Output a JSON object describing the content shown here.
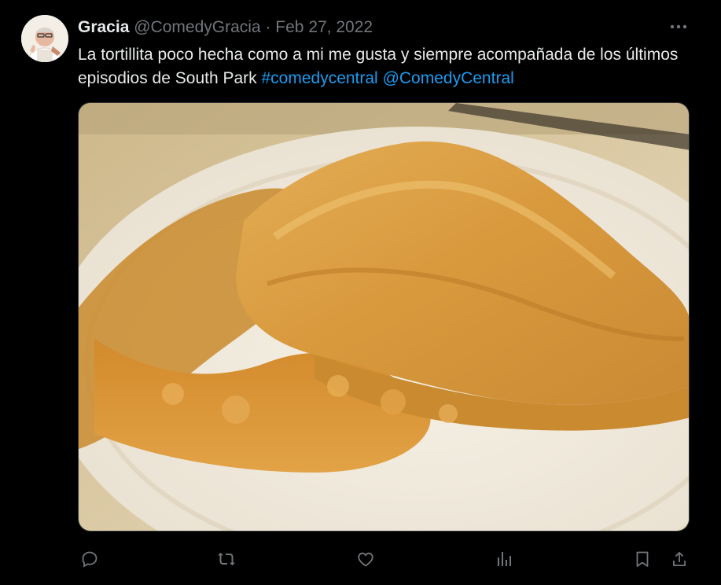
{
  "tweet": {
    "author_name": "Gracia",
    "author_handle": "@ComedyGracia",
    "separator": "·",
    "date": "Feb 27, 2022",
    "text_plain": "La tortillita poco hecha como a mi me gusta y siempre acompañada de los últimos episodios de South Park ",
    "hashtag": "#comedycentral",
    "mention": "@ComedyCentral"
  },
  "icons": {
    "more": "more-horizontal-icon",
    "reply": "reply-icon",
    "retweet": "retweet-icon",
    "like": "like-icon",
    "views": "views-icon",
    "bookmark": "bookmark-icon",
    "share": "share-icon"
  },
  "colors": {
    "background": "#000000",
    "text": "#e7e9ea",
    "muted": "#71767b",
    "link": "#1d9bf0"
  }
}
